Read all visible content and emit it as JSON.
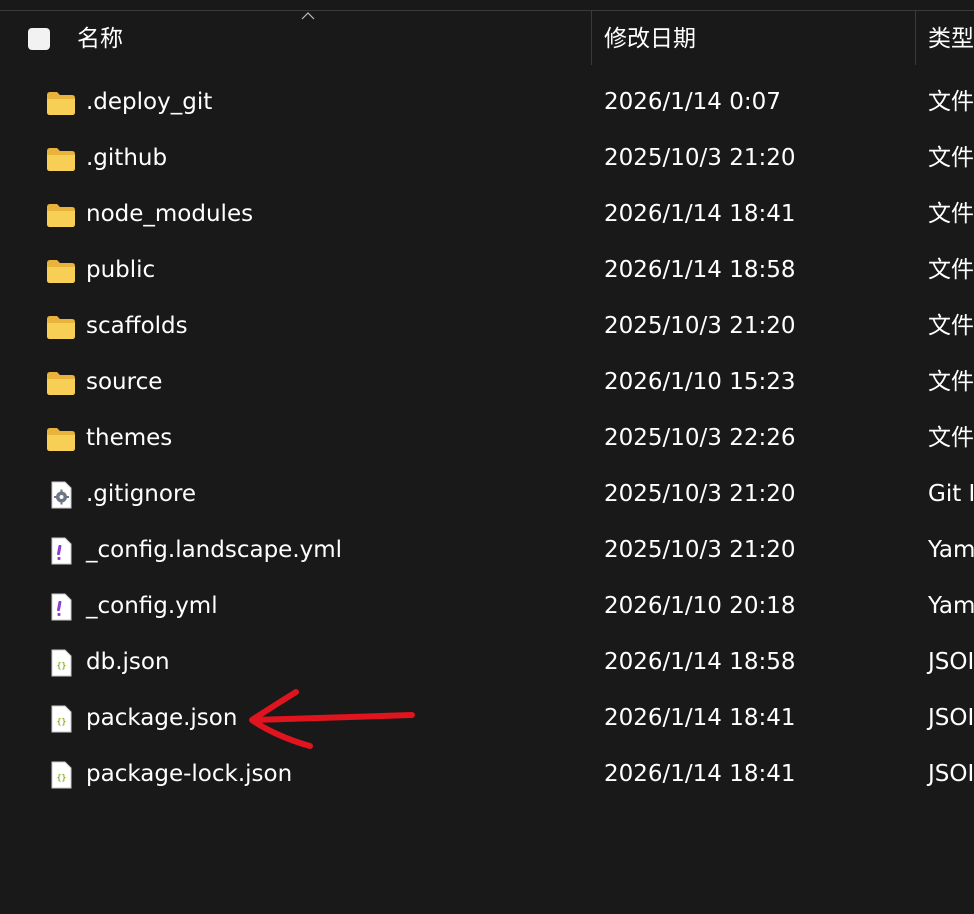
{
  "header": {
    "name_label": "名称",
    "date_label": "修改日期",
    "type_label": "类型"
  },
  "files": [
    {
      "name": ".deploy_git",
      "date": "2026/1/14 0:07",
      "type": "文件",
      "icon": "folder-icon"
    },
    {
      "name": ".github",
      "date": "2025/10/3 21:20",
      "type": "文件",
      "icon": "folder-icon"
    },
    {
      "name": "node_modules",
      "date": "2026/1/14 18:41",
      "type": "文件",
      "icon": "folder-icon"
    },
    {
      "name": "public",
      "date": "2026/1/14 18:58",
      "type": "文件",
      "icon": "folder-icon"
    },
    {
      "name": "scaffolds",
      "date": "2025/10/3 21:20",
      "type": "文件",
      "icon": "folder-icon"
    },
    {
      "name": "source",
      "date": "2026/1/10 15:23",
      "type": "文件",
      "icon": "folder-icon"
    },
    {
      "name": "themes",
      "date": "2025/10/3 22:26",
      "type": "文件",
      "icon": "folder-icon"
    },
    {
      "name": ".gitignore",
      "date": "2025/10/3 21:20",
      "type": "Git I",
      "icon": "gear-file-icon"
    },
    {
      "name": "_config.landscape.yml",
      "date": "2025/10/3 21:20",
      "type": "Yam",
      "icon": "yaml-file-icon"
    },
    {
      "name": "_config.yml",
      "date": "2026/1/10 20:18",
      "type": "Yam",
      "icon": "yaml-file-icon"
    },
    {
      "name": "db.json",
      "date": "2026/1/14 18:58",
      "type": "JSOI",
      "icon": "json-file-icon"
    },
    {
      "name": "package.json",
      "date": "2026/1/14 18:41",
      "type": "JSOI",
      "icon": "json-file-icon"
    },
    {
      "name": "package-lock.json",
      "date": "2026/1/14 18:41",
      "type": "JSOI",
      "icon": "json-file-icon"
    }
  ],
  "colors": {
    "background": "#191919",
    "folder": "#f4c548",
    "annotation": "#e0141e"
  }
}
